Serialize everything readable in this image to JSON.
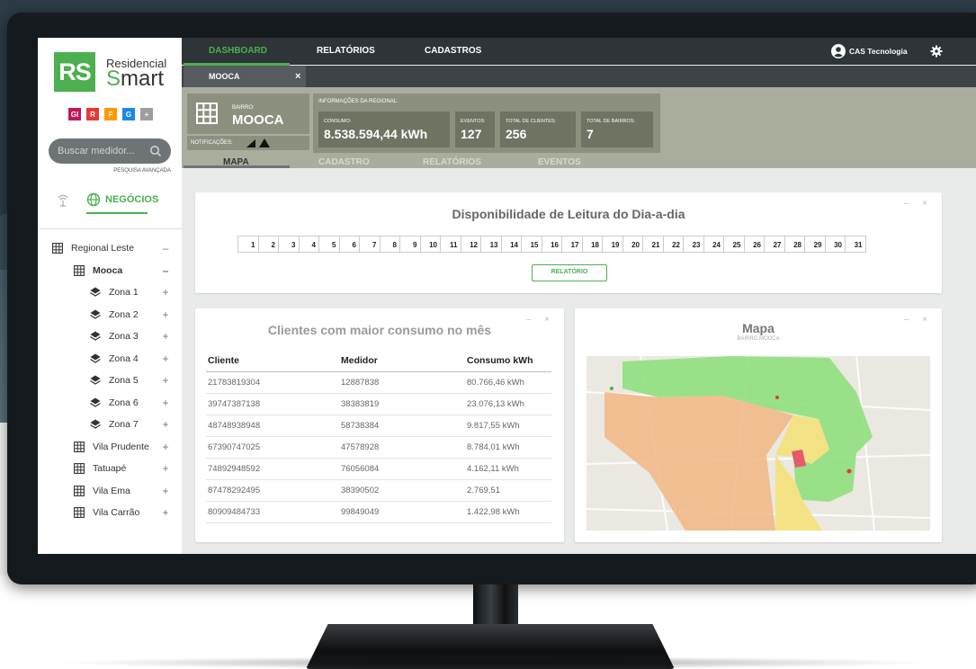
{
  "logo": {
    "mark": "RS",
    "line1": "Residencial",
    "line2_first": "S",
    "line2_rest": "mart"
  },
  "brands": [
    {
      "label": "GI",
      "color": "#c2185b"
    },
    {
      "label": "R",
      "color": "#e53935"
    },
    {
      "label": "F",
      "color": "#ff9800"
    },
    {
      "label": "G",
      "color": "#1e88e5"
    },
    {
      "label": "+",
      "color": "#9e9e9e"
    }
  ],
  "search": {
    "placeholder": "Buscar medidor...",
    "advanced": "PESQUISA AVANÇADA"
  },
  "sidebar_nav": {
    "business": "NEGÓCIOS"
  },
  "tree": [
    {
      "label": "Regional Leste",
      "ctrl": "–",
      "level": 0,
      "icon": "grid-icon"
    },
    {
      "label": "Mooca",
      "ctrl": "–",
      "level": 1,
      "icon": "grid-icon",
      "bold": true
    },
    {
      "label": "Zona 1",
      "ctrl": "+",
      "level": 2,
      "icon": "layers-icon"
    },
    {
      "label": "Zona 2",
      "ctrl": "+",
      "level": 2,
      "icon": "layers-icon"
    },
    {
      "label": "Zona 3",
      "ctrl": "+",
      "level": 2,
      "icon": "layers-icon"
    },
    {
      "label": "Zona 4",
      "ctrl": "+",
      "level": 2,
      "icon": "layers-icon"
    },
    {
      "label": "Zona 5",
      "ctrl": "+",
      "level": 2,
      "icon": "layers-icon"
    },
    {
      "label": "Zona 6",
      "ctrl": "+",
      "level": 2,
      "icon": "layers-icon"
    },
    {
      "label": "Zona 7",
      "ctrl": "+",
      "level": 2,
      "icon": "layers-icon"
    },
    {
      "label": "Vila Prudente",
      "ctrl": "+",
      "level": 1,
      "icon": "grid-icon"
    },
    {
      "label": "Tatuapé",
      "ctrl": "+",
      "level": 1,
      "icon": "grid-icon"
    },
    {
      "label": "Vila Ema",
      "ctrl": "+",
      "level": 1,
      "icon": "grid-icon"
    },
    {
      "label": "Vila Carrão",
      "ctrl": "+",
      "level": 1,
      "icon": "grid-icon"
    }
  ],
  "topnav": {
    "dashboard": "DASHBOARD",
    "reports": "RELATÓRIOS",
    "records": "CADASTROS",
    "user": "CAS Tecnologia"
  },
  "subtab": {
    "label": "MOOCA",
    "close": "×"
  },
  "bairro": {
    "small": "BAIRRO:",
    "name": "MOOCA",
    "notifications": "NOTIFICAÇÕES:"
  },
  "regional": {
    "title": "INFORMAÇÕES DA REGIONAL:",
    "consumo_label": "CONSUMO:",
    "consumo": "8.538.594,44 kWh",
    "eventos_label": "EVENTOS:",
    "eventos": "127",
    "clientes_label": "TOTAL DE CLIENTES:",
    "clientes": "256",
    "bairros_label": "TOTAL DE BAIRROS:",
    "bairros": "7"
  },
  "band_tabs": {
    "mapa": "MAPA",
    "cadastro": "CADASTRO",
    "relatorios": "RELATÓRIOS",
    "eventos": "EVENTOS"
  },
  "availability": {
    "title": "Disponibilidade de Leitura do Dia-a-dia",
    "button": "RELATÓRIO",
    "days": [
      "1",
      "2",
      "3",
      "4",
      "5",
      "6",
      "7",
      "8",
      "9",
      "10",
      "11",
      "12",
      "13",
      "14",
      "15",
      "16",
      "17",
      "18",
      "19",
      "20",
      "21",
      "22",
      "23",
      "24",
      "25",
      "26",
      "27",
      "28",
      "29",
      "30",
      "31"
    ]
  },
  "card_ctrl": "– ×",
  "clients": {
    "title": "Clientes com maior consumo no mês",
    "headers": [
      "Cliente",
      "Medidor",
      "Consumo kWh"
    ],
    "rows": [
      [
        "21783819304",
        "12887838",
        "80.766,46 kWh"
      ],
      [
        "39747387138",
        "38383819",
        "23.076,13 kWh"
      ],
      [
        "48748938948",
        "58738384",
        "9.817,55 kWh"
      ],
      [
        "67390747025",
        "47578928",
        "8.784,01 kWh"
      ],
      [
        "74892948592",
        "76056084",
        "4.162,11 kWh"
      ],
      [
        "87478292495",
        "38390502",
        "2.769,51"
      ],
      [
        "80909484733",
        "99849049",
        "1.422,98 kWh"
      ]
    ]
  },
  "map": {
    "title": "Mapa",
    "subtitle": "BAIRRO MOOCA"
  }
}
